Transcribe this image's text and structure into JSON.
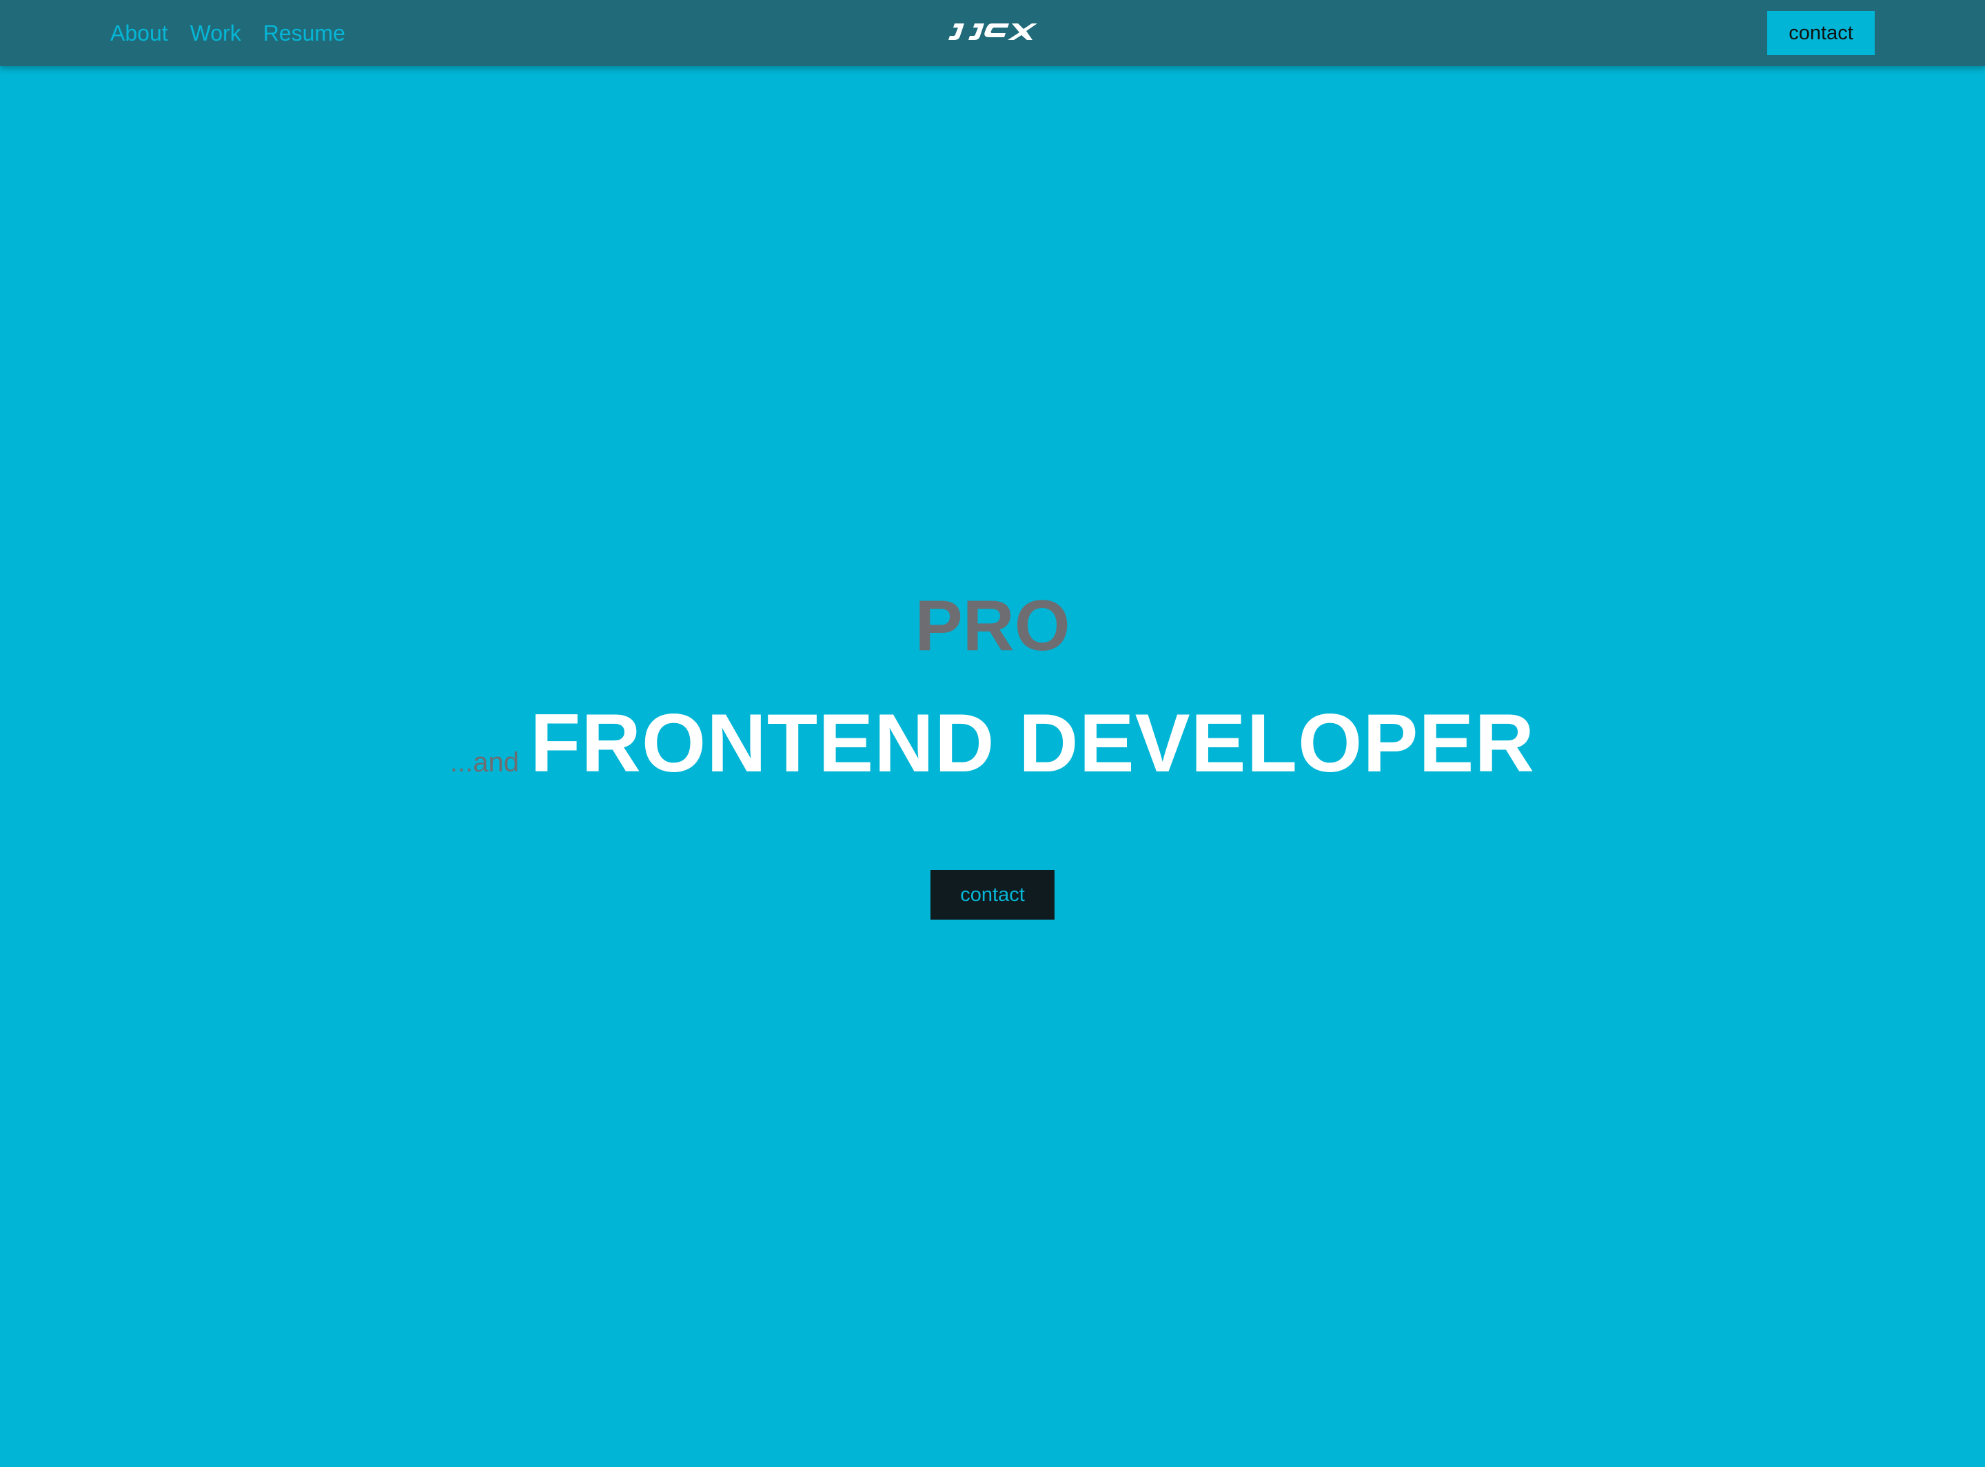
{
  "nav": {
    "links": [
      "About",
      "Work",
      "Resume"
    ],
    "logo_text": "JJCX",
    "contact_label": "contact"
  },
  "hero": {
    "eyebrow": "PRO",
    "and_text": "...and",
    "role": "FRONTEND DEVELOPER",
    "contact_label": "contact"
  },
  "colors": {
    "background": "#00b5d5",
    "navbar": "#206a79",
    "link": "#06b6d6",
    "muted_text": "#6e6e72",
    "headline": "#ffffff",
    "dark_button": "#101b20"
  }
}
